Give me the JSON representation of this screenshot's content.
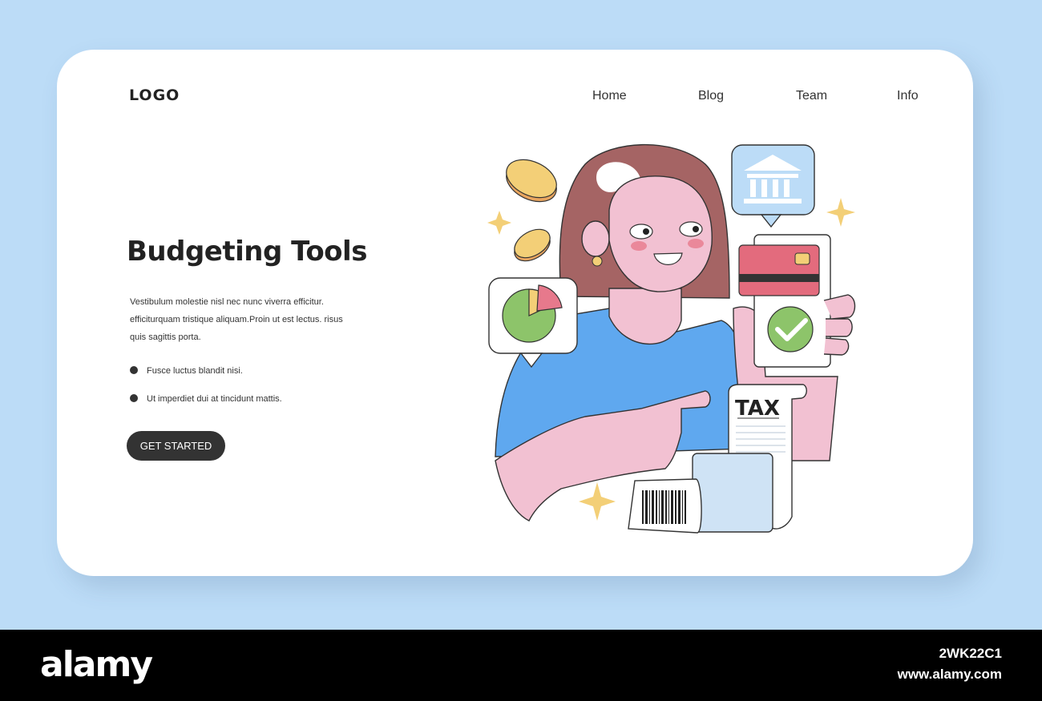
{
  "header": {
    "logo": "LOGO",
    "nav": [
      "Home",
      "Blog",
      "Team",
      "Info"
    ]
  },
  "hero": {
    "title": "Budgeting Tools",
    "description": "Vestibulum molestie nisl nec nunc viverra efficitur. efficiturquam tristique aliquam.Proin ut est lectus. risus quis sagittis porta.",
    "bullets": [
      "Fusce luctus blandit nisi.",
      "Ut imperdiet dui at tincidunt mattis."
    ],
    "cta": "GET STARTED"
  },
  "illustration": {
    "receipt_label": "TAX",
    "icons": [
      "coin-icon",
      "pie-chart-icon",
      "bank-icon",
      "credit-card-icon",
      "checkmark-icon",
      "barcode-icon",
      "sparkle-icon"
    ]
  },
  "watermark": {
    "brand": "alamy",
    "image_id": "2WK22C1",
    "url": "www.alamy.com"
  },
  "colors": {
    "background": "#bcdcf7",
    "card": "#ffffff",
    "button": "#333333",
    "shirt": "#5fa8ef",
    "skin": "#f2c1d2",
    "hair": "#a56464",
    "card_red": "#e36b7d",
    "check_green": "#8dc46a",
    "coin": "#f3cf77"
  }
}
